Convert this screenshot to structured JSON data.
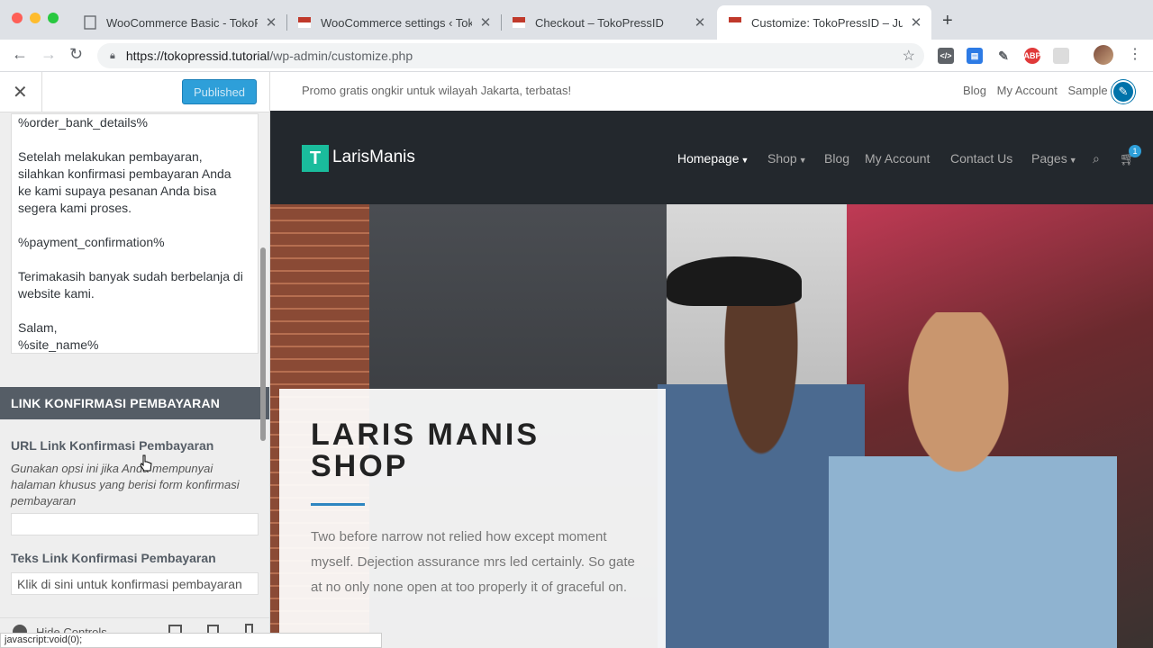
{
  "browser": {
    "tabs": [
      {
        "title": "WooCommerce Basic - TokoPr",
        "active": false
      },
      {
        "title": "WooCommerce settings ‹ Tok",
        "active": false
      },
      {
        "title": "Checkout – TokoPressID",
        "active": false
      },
      {
        "title": "Customize: TokoPressID – Just",
        "active": true
      }
    ],
    "url_host": "https://tokopressid.tutorial",
    "url_path": "/wp-admin/customize.php"
  },
  "customizer": {
    "publish_label": "Published",
    "email_body": "%order_bank_details%\n\nSetelah melakukan pembayaran,\nsilahkan konfirmasi pembayaran Anda\nke kami supaya pesanan Anda bisa\nsegera kami proses.\n\n%payment_confirmation%\n\nTerimakasih banyak sudah berbelanja di\nwebsite kami.\n\nSalam,\n%site_name%",
    "section_title": "LINK KONFIRMASI PEMBAYARAN",
    "url_control": {
      "title": "URL Link Konfirmasi Pembayaran",
      "description": "Gunakan opsi ini jika Anda mempunyai halaman khusus yang berisi form konfirmasi pembayaran",
      "value": ""
    },
    "text_control": {
      "title": "Teks Link Konfirmasi Pembayaran",
      "value": "Klik di sini untuk konfirmasi pembayaran"
    },
    "hide_controls_label": "Hide Controls",
    "status_text": "javascript:void(0);"
  },
  "site": {
    "promo": "Promo gratis ongkir untuk wilayah Jakarta, terbatas!",
    "top_links": [
      "Blog",
      "My Account",
      "Sample P"
    ],
    "logo_letter": "T",
    "logo_text": "LarisManis",
    "nav": [
      {
        "label": "Homepage",
        "caret": true,
        "active": true
      },
      {
        "label": "Shop",
        "caret": true,
        "active": false
      },
      {
        "label": "Blog",
        "caret": false,
        "active": false
      },
      {
        "label": "My Account",
        "caret": false,
        "active": false
      },
      {
        "label": "Contact Us",
        "caret": false,
        "active": false
      },
      {
        "label": "Pages",
        "caret": true,
        "active": false
      }
    ],
    "cart_count": "1",
    "hero_title": "LARIS MANIS SHOP",
    "hero_text": "Two before narrow not relied how except moment myself. Dejection assurance mrs led certainly. So gate at no only none open at too properly it of graceful on."
  }
}
